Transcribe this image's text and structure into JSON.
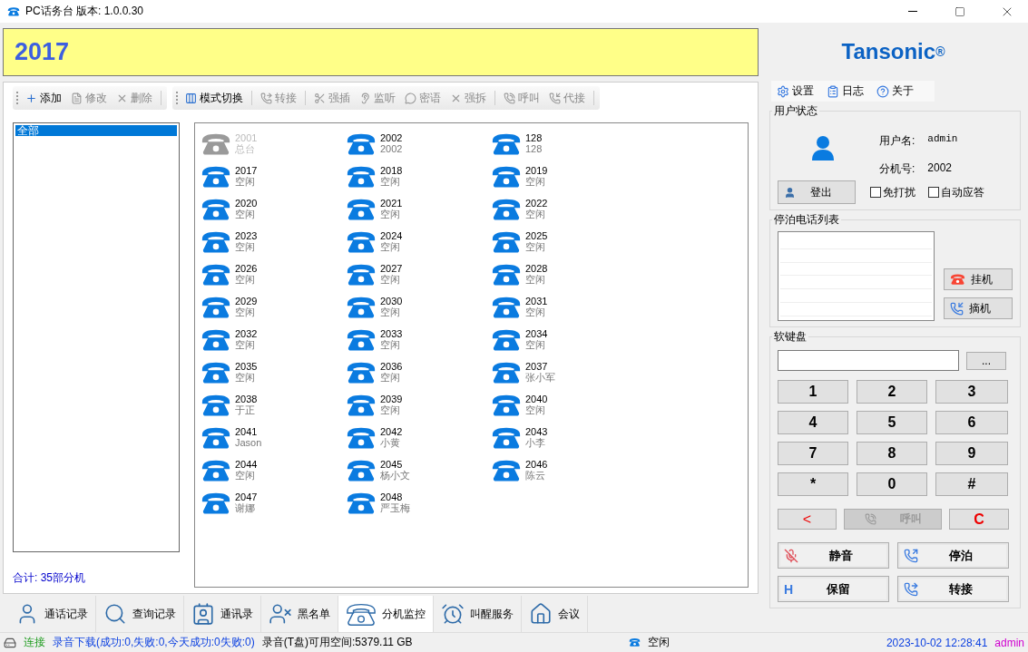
{
  "window": {
    "title": "PC话务台  版本: 1.0.0.30"
  },
  "display": {
    "number": "2017"
  },
  "toolbar": {
    "groups": [
      [
        {
          "label": "添加",
          "disabled": false
        },
        {
          "label": "修改",
          "disabled": true
        },
        {
          "label": "删除",
          "disabled": true
        }
      ],
      [
        {
          "label": "模式切换",
          "disabled": false
        }
      ],
      [
        {
          "label": "转接",
          "disabled": true
        }
      ],
      [
        {
          "label": "强插",
          "disabled": true
        },
        {
          "label": "监听",
          "disabled": true
        },
        {
          "label": "密语",
          "disabled": true
        },
        {
          "label": "强拆",
          "disabled": true
        }
      ],
      [
        {
          "label": "呼叫",
          "disabled": true
        },
        {
          "label": "代接",
          "disabled": true
        }
      ]
    ]
  },
  "groups": [
    {
      "label": "全部",
      "selected": true
    }
  ],
  "total": "合计: 35部分机",
  "extensions": [
    {
      "number": "2001",
      "name": "总台",
      "offline": true
    },
    {
      "number": "2002",
      "name": "2002",
      "offline": false
    },
    {
      "number": "128",
      "name": "128",
      "offline": false
    },
    {
      "number": "2017",
      "name": "空闲",
      "offline": false
    },
    {
      "number": "2018",
      "name": "空闲",
      "offline": false
    },
    {
      "number": "2019",
      "name": "空闲",
      "offline": false
    },
    {
      "number": "2020",
      "name": "空闲",
      "offline": false
    },
    {
      "number": "2021",
      "name": "空闲",
      "offline": false
    },
    {
      "number": "2022",
      "name": "空闲",
      "offline": false
    },
    {
      "number": "2023",
      "name": "空闲",
      "offline": false
    },
    {
      "number": "2024",
      "name": "空闲",
      "offline": false
    },
    {
      "number": "2025",
      "name": "空闲",
      "offline": false
    },
    {
      "number": "2026",
      "name": "空闲",
      "offline": false
    },
    {
      "number": "2027",
      "name": "空闲",
      "offline": false
    },
    {
      "number": "2028",
      "name": "空闲",
      "offline": false
    },
    {
      "number": "2029",
      "name": "空闲",
      "offline": false
    },
    {
      "number": "2030",
      "name": "空闲",
      "offline": false
    },
    {
      "number": "2031",
      "name": "空闲",
      "offline": false
    },
    {
      "number": "2032",
      "name": "空闲",
      "offline": false
    },
    {
      "number": "2033",
      "name": "空闲",
      "offline": false
    },
    {
      "number": "2034",
      "name": "空闲",
      "offline": false
    },
    {
      "number": "2035",
      "name": "空闲",
      "offline": false
    },
    {
      "number": "2036",
      "name": "空闲",
      "offline": false
    },
    {
      "number": "2037",
      "name": "张小军",
      "offline": false
    },
    {
      "number": "2038",
      "name": "于正",
      "offline": false
    },
    {
      "number": "2039",
      "name": "空闲",
      "offline": false
    },
    {
      "number": "2040",
      "name": "空闲",
      "offline": false
    },
    {
      "number": "2041",
      "name": "Jason",
      "offline": false
    },
    {
      "number": "2042",
      "name": "小黄",
      "offline": false
    },
    {
      "number": "2043",
      "name": "小李",
      "offline": false
    },
    {
      "number": "2044",
      "name": "空闲",
      "offline": false
    },
    {
      "number": "2045",
      "name": "杨小文",
      "offline": false
    },
    {
      "number": "2046",
      "name": "陈云",
      "offline": false
    },
    {
      "number": "2047",
      "name": "谢娜",
      "offline": false
    },
    {
      "number": "2048",
      "name": "严玉梅",
      "offline": false
    }
  ],
  "bottom_tabs": [
    {
      "label": "通话记录",
      "selected": false
    },
    {
      "label": "查询记录",
      "selected": false
    },
    {
      "label": "通讯录",
      "selected": false
    },
    {
      "label": "黑名单",
      "selected": false
    },
    {
      "label": "分机监控",
      "selected": true
    },
    {
      "label": "叫醒服务",
      "selected": false
    },
    {
      "label": "会议",
      "selected": false
    }
  ],
  "logo": {
    "name": "Tansonic",
    "mark": "®"
  },
  "top_menu": [
    {
      "label": "设置"
    },
    {
      "label": "日志"
    },
    {
      "label": "关于"
    }
  ],
  "user_status": {
    "title": "用户状态",
    "username_label": "用户名:",
    "username": "admin",
    "extension_label": "分机号:",
    "extension": "2002",
    "logout": "登出",
    "options": [
      {
        "label": "免打扰",
        "checked": false
      },
      {
        "label": "自动应答",
        "checked": false
      }
    ]
  },
  "parked": {
    "title": "停泊电话列表",
    "buttons": [
      {
        "label": "挂机"
      },
      {
        "label": "摘机"
      }
    ]
  },
  "keypad": {
    "title": "软键盘",
    "more": "...",
    "keys": [
      "1",
      "2",
      "3",
      "4",
      "5",
      "6",
      "7",
      "8",
      "9",
      "*",
      "0",
      "#"
    ],
    "backspace": "<",
    "call": {
      "label": "呼叫",
      "disabled": true
    },
    "clear": "C",
    "actions": [
      {
        "label": "静音"
      },
      {
        "label": "停泊"
      },
      {
        "label": "保留",
        "badge": "H"
      },
      {
        "label": "转接"
      }
    ]
  },
  "status_bar": {
    "connection": "连接",
    "download": "录音下载(成功:0,失败:0,今天成功:0失败:0)",
    "space": "录音(T盘)可用空间:5379.11 GB",
    "state": "空闲",
    "datetime": "2023-10-02 12:28:41",
    "user": "admin"
  }
}
